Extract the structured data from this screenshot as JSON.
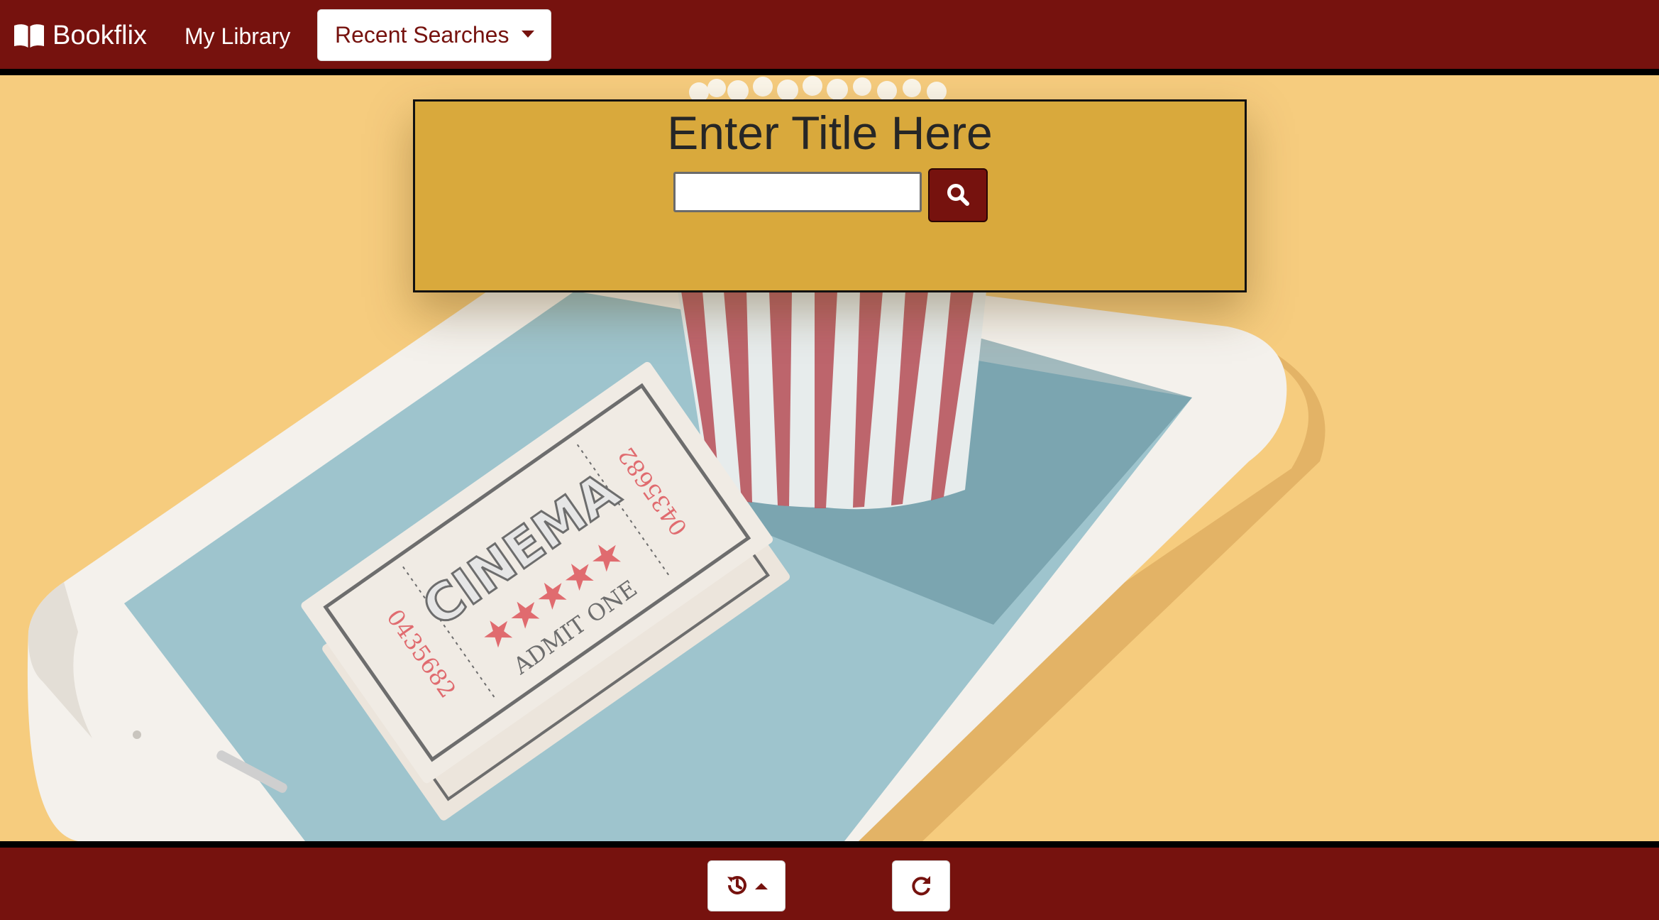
{
  "navbar": {
    "brand_icon": "book-open-icon",
    "brand_label": "Bookflix",
    "library_link": "My Library",
    "recent_searches_label": "Recent Searches"
  },
  "search": {
    "heading": "Enter Title Here",
    "input_value": "",
    "button_icon": "search-icon"
  },
  "hero": {
    "ticket_word": "CINEMA",
    "ticket_admit": "ADMIT ONE",
    "ticket_number": "0435682",
    "ticket_stars": 5
  },
  "footer": {
    "history_icon": "history-icon",
    "refresh_icon": "redo-icon"
  },
  "colors": {
    "brand": "#76120e",
    "card": "#d9a93c",
    "background": "#f6cc7e"
  }
}
